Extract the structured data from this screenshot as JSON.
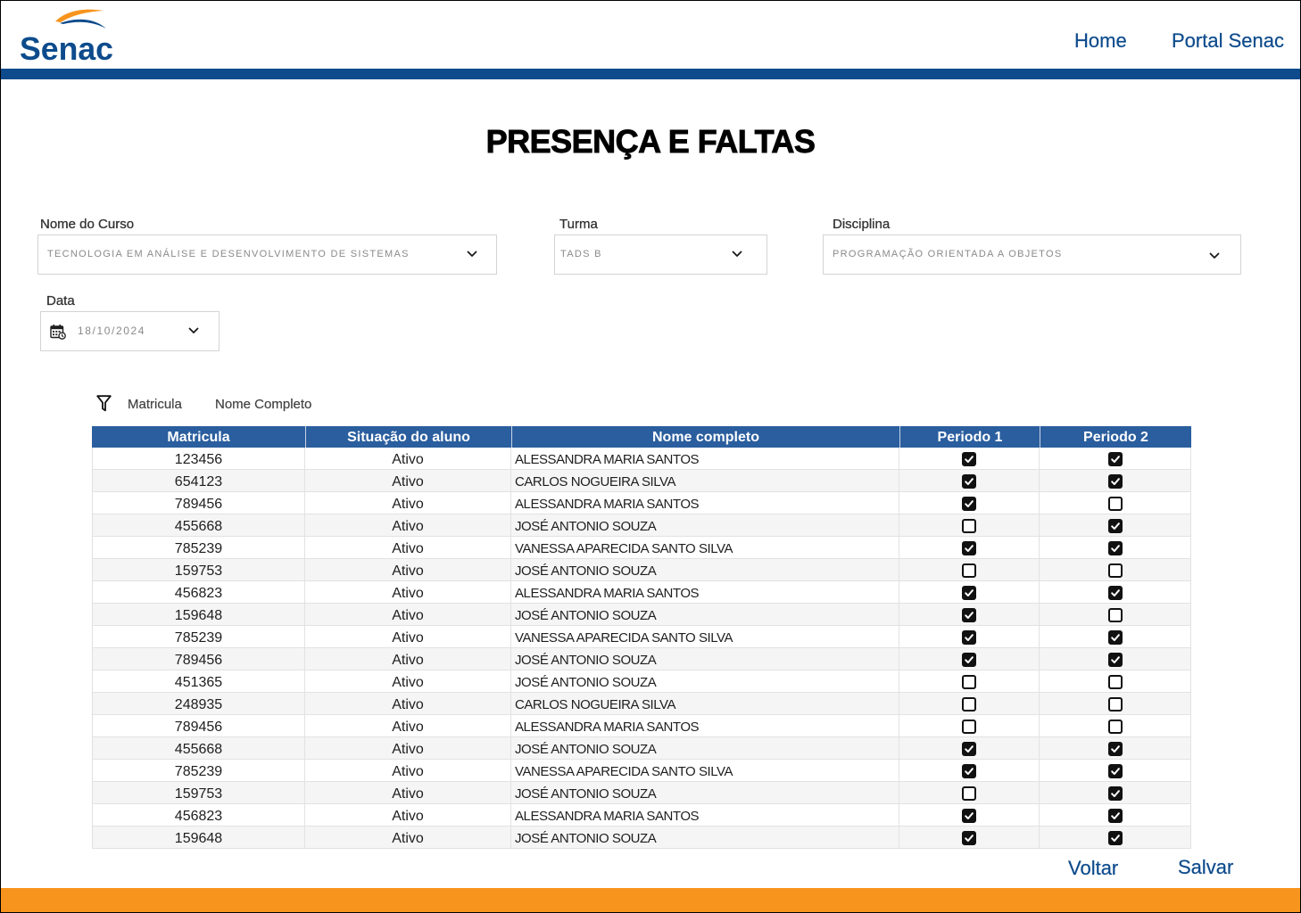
{
  "header": {
    "logo_text": "Senac",
    "nav": [
      {
        "label": "Home"
      },
      {
        "label": "Portal Senac"
      }
    ]
  },
  "page": {
    "title": "PRESENÇA E FALTAS"
  },
  "filters": {
    "curso": {
      "label": "Nome do Curso",
      "value": "TECNOLOGIA EM ANÁLISE E DESENVOLVIMENTO DE SISTEMAS"
    },
    "turma": {
      "label": "Turma",
      "value": "TADS B"
    },
    "disciplina": {
      "label": "Disciplina",
      "value": "PROGRAMAÇÃO ORIENTADA A OBJETOS"
    },
    "data": {
      "label": "Data",
      "value": "18/10/2024"
    }
  },
  "table_filter": {
    "options": [
      "Matricula",
      "Nome Completo"
    ]
  },
  "table": {
    "columns": [
      "Matricula",
      "Situação do aluno",
      "Nome completo",
      "Periodo 1",
      "Periodo 2"
    ],
    "rows": [
      {
        "matricula": "123456",
        "situacao": "Ativo",
        "nome": "ALESSANDRA MARIA SANTOS",
        "periodo1": true,
        "periodo2": true
      },
      {
        "matricula": "654123",
        "situacao": "Ativo",
        "nome": "CARLOS NOGUEIRA SILVA",
        "periodo1": true,
        "periodo2": true
      },
      {
        "matricula": "789456",
        "situacao": "Ativo",
        "nome": "ALESSANDRA MARIA SANTOS",
        "periodo1": true,
        "periodo2": false
      },
      {
        "matricula": "455668",
        "situacao": "Ativo",
        "nome": "JOSÉ ANTONIO SOUZA",
        "periodo1": false,
        "periodo2": true
      },
      {
        "matricula": "785239",
        "situacao": "Ativo",
        "nome": "VANESSA APARECIDA SANTO SILVA",
        "periodo1": true,
        "periodo2": true
      },
      {
        "matricula": "159753",
        "situacao": "Ativo",
        "nome": "JOSÉ ANTONIO SOUZA",
        "periodo1": false,
        "periodo2": false
      },
      {
        "matricula": "456823",
        "situacao": "Ativo",
        "nome": "ALESSANDRA MARIA SANTOS",
        "periodo1": true,
        "periodo2": true
      },
      {
        "matricula": "159648",
        "situacao": "Ativo",
        "nome": "JOSÉ ANTONIO SOUZA",
        "periodo1": true,
        "periodo2": false
      },
      {
        "matricula": "785239",
        "situacao": "Ativo",
        "nome": "VANESSA APARECIDA SANTO SILVA",
        "periodo1": true,
        "periodo2": true
      },
      {
        "matricula": "789456",
        "situacao": "Ativo",
        "nome": "JOSÉ ANTONIO SOUZA",
        "periodo1": true,
        "periodo2": true
      },
      {
        "matricula": "451365",
        "situacao": "Ativo",
        "nome": "JOSÉ ANTONIO SOUZA",
        "periodo1": false,
        "periodo2": false
      },
      {
        "matricula": "248935",
        "situacao": "Ativo",
        "nome": "CARLOS NOGUEIRA SILVA",
        "periodo1": false,
        "periodo2": false
      },
      {
        "matricula": "789456",
        "situacao": "Ativo",
        "nome": "ALESSANDRA MARIA SANTOS",
        "periodo1": false,
        "periodo2": false
      },
      {
        "matricula": "455668",
        "situacao": "Ativo",
        "nome": "JOSÉ ANTONIO SOUZA",
        "periodo1": true,
        "periodo2": true
      },
      {
        "matricula": "785239",
        "situacao": "Ativo",
        "nome": "VANESSA APARECIDA SANTO SILVA",
        "periodo1": true,
        "periodo2": true
      },
      {
        "matricula": "159753",
        "situacao": "Ativo",
        "nome": "JOSÉ ANTONIO SOUZA",
        "periodo1": false,
        "periodo2": true
      },
      {
        "matricula": "456823",
        "situacao": "Ativo",
        "nome": "ALESSANDRA MARIA SANTOS",
        "periodo1": true,
        "periodo2": true
      },
      {
        "matricula": "159648",
        "situacao": "Ativo",
        "nome": "JOSÉ ANTONIO SOUZA",
        "periodo1": true,
        "periodo2": true
      }
    ]
  },
  "actions": {
    "back": "Voltar",
    "save": "Salvar"
  },
  "icons": {
    "logo": "senac-logo",
    "field_dropdown": "chevron-down-icon",
    "date_picker": "calendar-icon",
    "table_filter": "filter-icon",
    "checked": "checkbox-checked-icon",
    "unchecked": "checkbox-unchecked-icon"
  },
  "colors": {
    "brand_blue": "#0d4b8c",
    "table_header": "#2a5e9e",
    "accent_orange": "#f7941d",
    "row_stripe": "#f5f5f5"
  }
}
